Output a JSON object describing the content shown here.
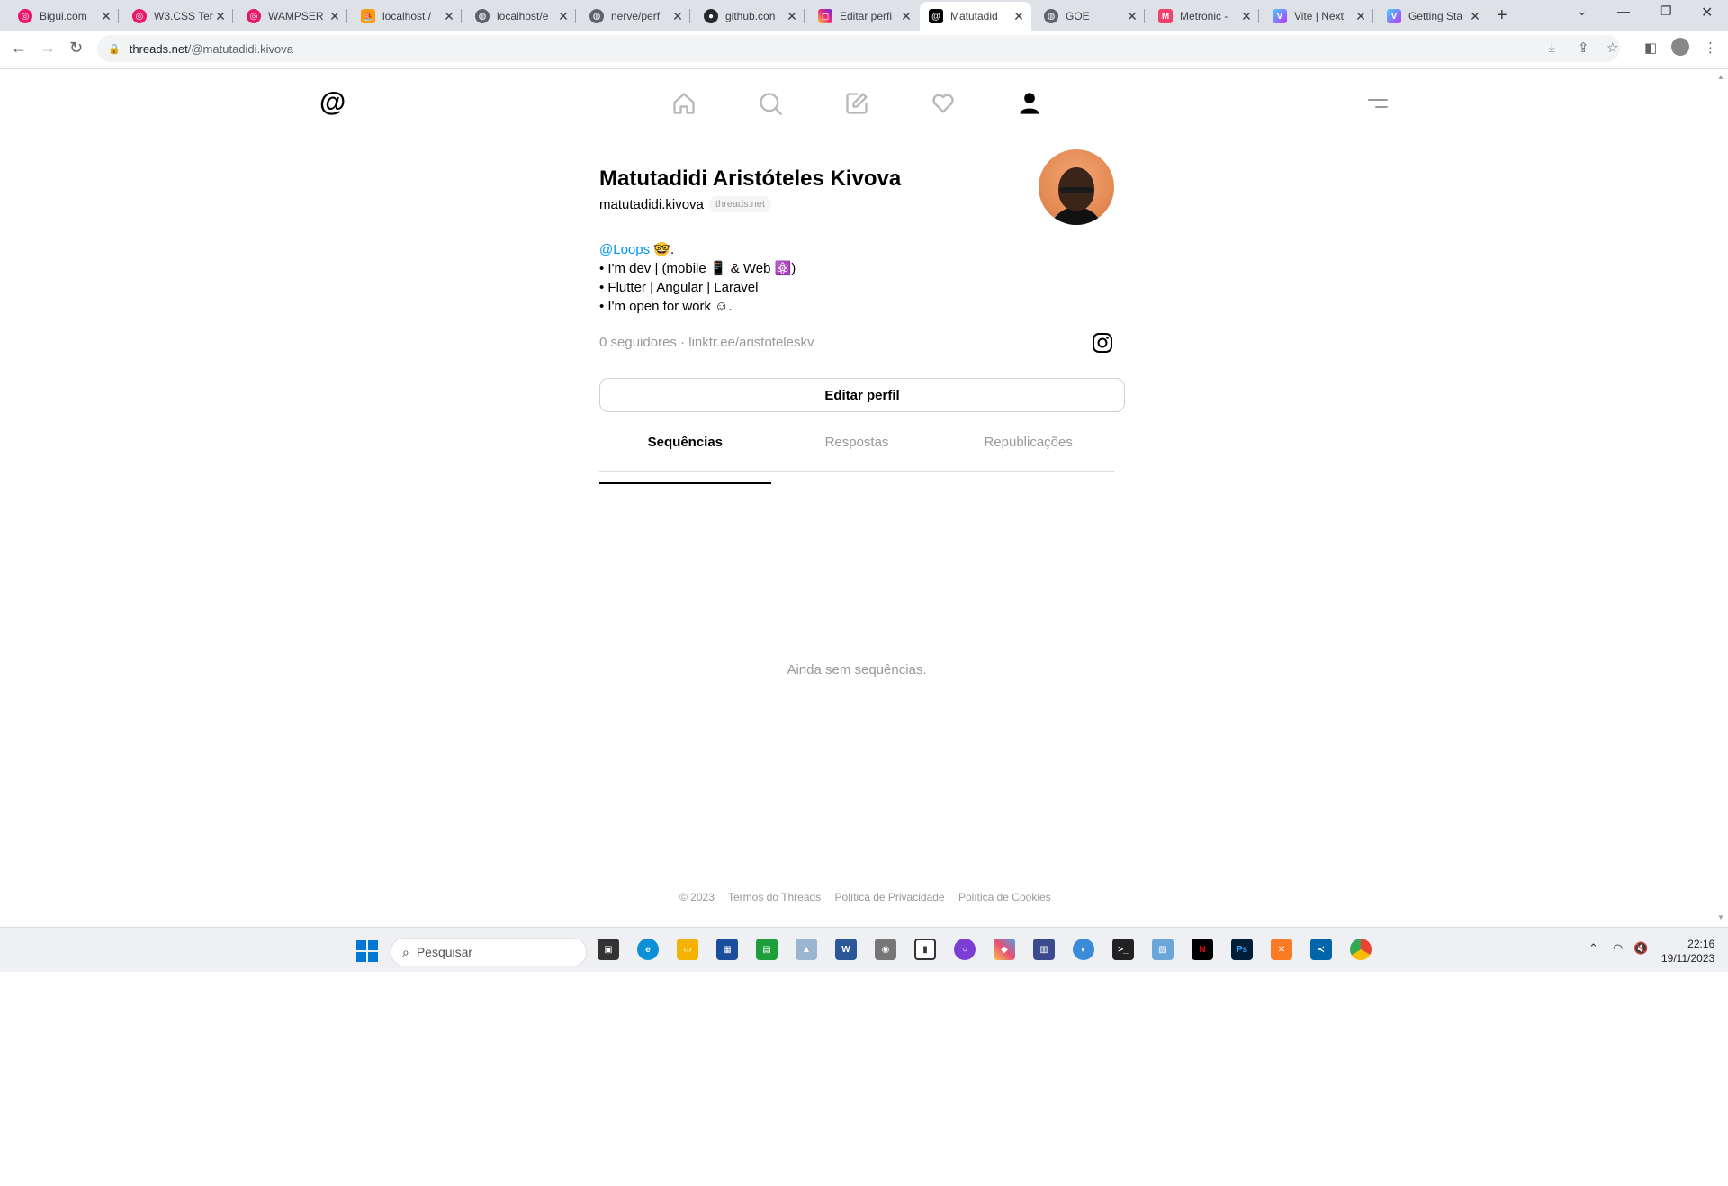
{
  "browser": {
    "tabs": [
      {
        "title": "Bigui.com",
        "favicon": "pink-ring"
      },
      {
        "title": "W3.CSS Ter",
        "favicon": "pink-ring"
      },
      {
        "title": "WAMPSER",
        "favicon": "pink-ring"
      },
      {
        "title": "localhost /",
        "favicon": "phpmyadmin"
      },
      {
        "title": "localhost/e",
        "favicon": "globe"
      },
      {
        "title": "nerve/perf",
        "favicon": "globe"
      },
      {
        "title": "github.con",
        "favicon": "github"
      },
      {
        "title": "Editar perfi",
        "favicon": "instagram"
      },
      {
        "title": "Matutadid",
        "favicon": "threads"
      },
      {
        "title": "GOE",
        "favicon": "globe"
      },
      {
        "title": "Metronic -",
        "favicon": "metronic"
      },
      {
        "title": "Vite | Next",
        "favicon": "vite"
      },
      {
        "title": "Getting Sta",
        "favicon": "vite"
      }
    ],
    "url": {
      "host": "threads.net",
      "path": "/@matutadidi.kivova"
    }
  },
  "threads": {
    "logo": "@",
    "profile": {
      "name": "Matutadidi Aristóteles Kivova",
      "username": "matutadidi.kivova",
      "domain_badge": "threads.net",
      "bio_mention": "@Loops",
      "bio_line1_rest": " 🤓.",
      "bio_line2": "• I'm dev | (mobile 📱 & Web ⚛️)",
      "bio_line3": "• Flutter | Angular | Laravel",
      "bio_line4": "• I'm open for work ☺.",
      "followers": "0 seguidores",
      "meta_sep": " · ",
      "link": "linktr.ee/aristoteleskv"
    },
    "edit_button": "Editar perfil",
    "tabs": [
      "Sequências",
      "Respostas",
      "Republicações"
    ],
    "empty_state": "Ainda sem sequências.",
    "footer": [
      "© 2023",
      "Termos do Threads",
      "Política de Privacidade",
      "Política de Cookies"
    ]
  },
  "taskbar": {
    "search_placeholder": "Pesquisar",
    "time": "22:16",
    "date": "19/11/2023"
  }
}
